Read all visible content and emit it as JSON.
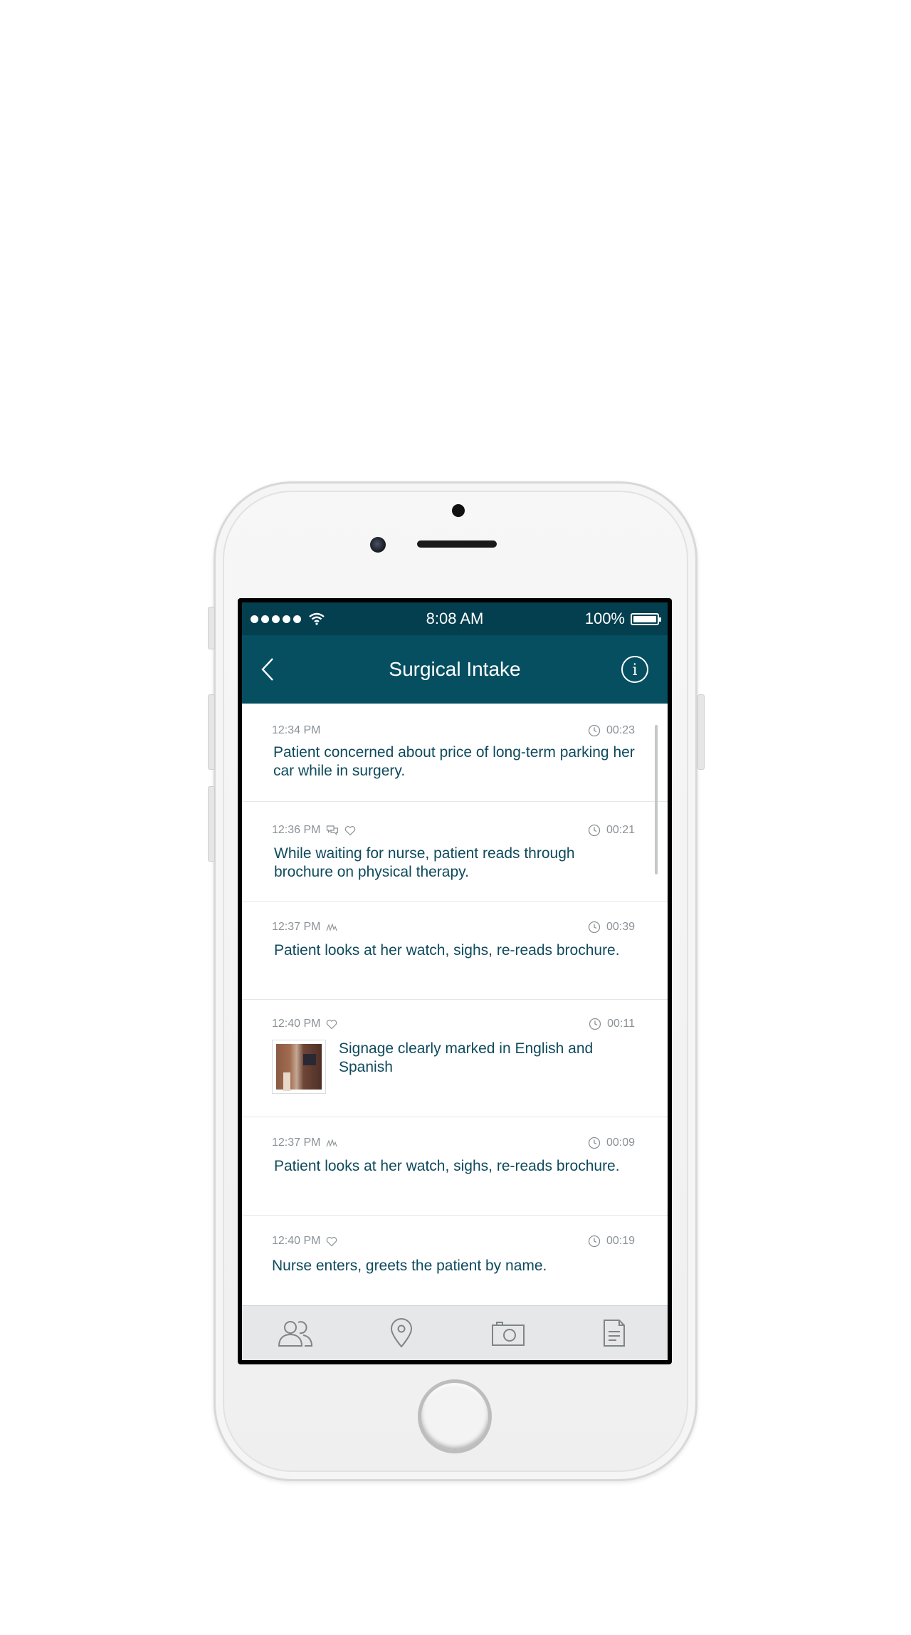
{
  "status_bar": {
    "time": "8:08 AM",
    "battery": "100%"
  },
  "header": {
    "title": "Surgical Intake"
  },
  "entries": [
    {
      "time": "12:34 PM",
      "duration": "00:23",
      "text": "Patient concerned about price of long-term parking her car while in surgery.",
      "tags": []
    },
    {
      "time": "12:36 PM",
      "duration": "00:21",
      "text": "While waiting for nurse, patient reads through brochure on physical therapy.",
      "tags": [
        "comment-icon",
        "heart-icon"
      ]
    },
    {
      "time": "12:37 PM",
      "duration": "00:39",
      "text": "Patient looks at her watch, sighs, re-reads brochure.",
      "tags": [
        "signature-icon"
      ]
    },
    {
      "time": "12:40 PM",
      "duration": "00:11",
      "text": "Signage clearly marked in English and Spanish",
      "tags": [
        "heart-icon"
      ],
      "has_photo": true
    },
    {
      "time": "12:37 PM",
      "duration": "00:09",
      "text": "Patient looks at her watch, sighs, re-reads brochure.",
      "tags": [
        "signature-icon"
      ]
    },
    {
      "time": "12:40 PM",
      "duration": "00:19",
      "text": "Nurse enters, greets the patient by name.",
      "tags": [
        "heart-icon"
      ]
    }
  ],
  "tabs": [
    {
      "icon": "people-icon"
    },
    {
      "icon": "location-pin-icon"
    },
    {
      "icon": "camera-icon"
    },
    {
      "icon": "document-icon"
    }
  ],
  "colors": {
    "status_bar_bg": "#033f4f",
    "nav_bar_bg": "#054f61",
    "entry_text": "#0e4a5c",
    "meta_text": "#8a9195"
  }
}
